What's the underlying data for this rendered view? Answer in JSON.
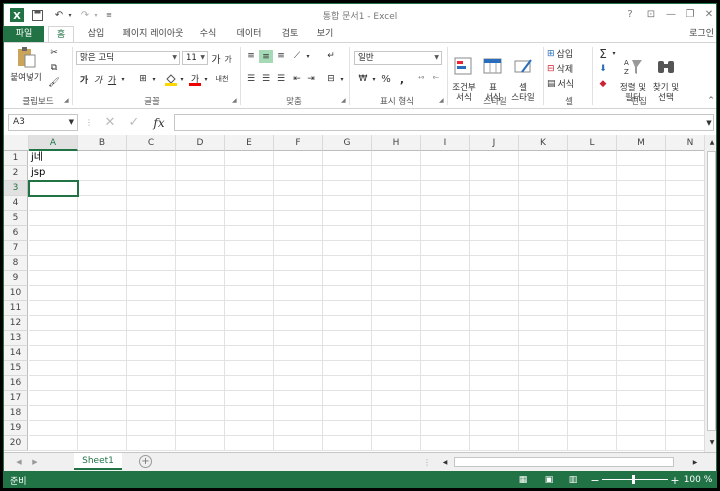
{
  "titlebar": {
    "title": "통합 문서1 - Excel",
    "help": "?",
    "minimize": "—",
    "restore": "❐",
    "close": "✕"
  },
  "tabs": [
    {
      "label": "파일",
      "active": false
    },
    {
      "label": "홈",
      "active": true
    },
    {
      "label": "삽입",
      "active": false
    },
    {
      "label": "페이지 레이아웃",
      "active": false
    },
    {
      "label": "수식",
      "active": false
    },
    {
      "label": "데이터",
      "active": false
    },
    {
      "label": "검토",
      "active": false
    },
    {
      "label": "보기",
      "active": false
    }
  ],
  "login": "로그인",
  "ribbon": {
    "clipboard": {
      "paste": "붙여넣기",
      "label": "클립보드"
    },
    "font": {
      "name": "맑은 고딕",
      "size": "11",
      "grow": "가",
      "shrink": "가",
      "bold": "가",
      "italic": "가",
      "underline": "가",
      "phonetic": "내천",
      "label": "글꼴"
    },
    "alignment": {
      "label": "맞춤"
    },
    "number": {
      "format": "일반",
      "percent": "%",
      "comma": ",",
      "label": "표시 형식"
    },
    "styles": {
      "conditional": "조건부\n서식",
      "table": "표\n서식",
      "cell": "셀\n스타일",
      "label": "스타일"
    },
    "cells": {
      "insert": "삽입",
      "delete": "삭제",
      "format": "서식",
      "label": "셀"
    },
    "editing": {
      "sum": "Σ",
      "sort": "정렬 및\n필터",
      "find": "찾기 및\n선택",
      "label": "편집"
    }
  },
  "formula_bar": {
    "name_box": "A3",
    "cancel": "✕",
    "enter": "✓",
    "fx": "fx",
    "value": ""
  },
  "columns": [
    "A",
    "B",
    "C",
    "D",
    "E",
    "F",
    "G",
    "H",
    "I",
    "J",
    "K",
    "L",
    "M",
    "N"
  ],
  "rows": [
    "1",
    "2",
    "3",
    "4",
    "5",
    "6",
    "7",
    "8",
    "9",
    "10",
    "11",
    "12",
    "13",
    "14",
    "15",
    "16",
    "17",
    "18",
    "19",
    "20"
  ],
  "cells": {
    "A1": "j네",
    "A2": "jsp"
  },
  "sheets": [
    {
      "name": "Sheet1",
      "active": true
    }
  ],
  "add_sheet": "+",
  "status": {
    "ready": "준비",
    "zoom": "100 %",
    "minus": "−",
    "plus": "+"
  },
  "colors": {
    "accent": "#217346",
    "header_bg": "#f3f3f3",
    "grid": "#e2e2e2"
  }
}
